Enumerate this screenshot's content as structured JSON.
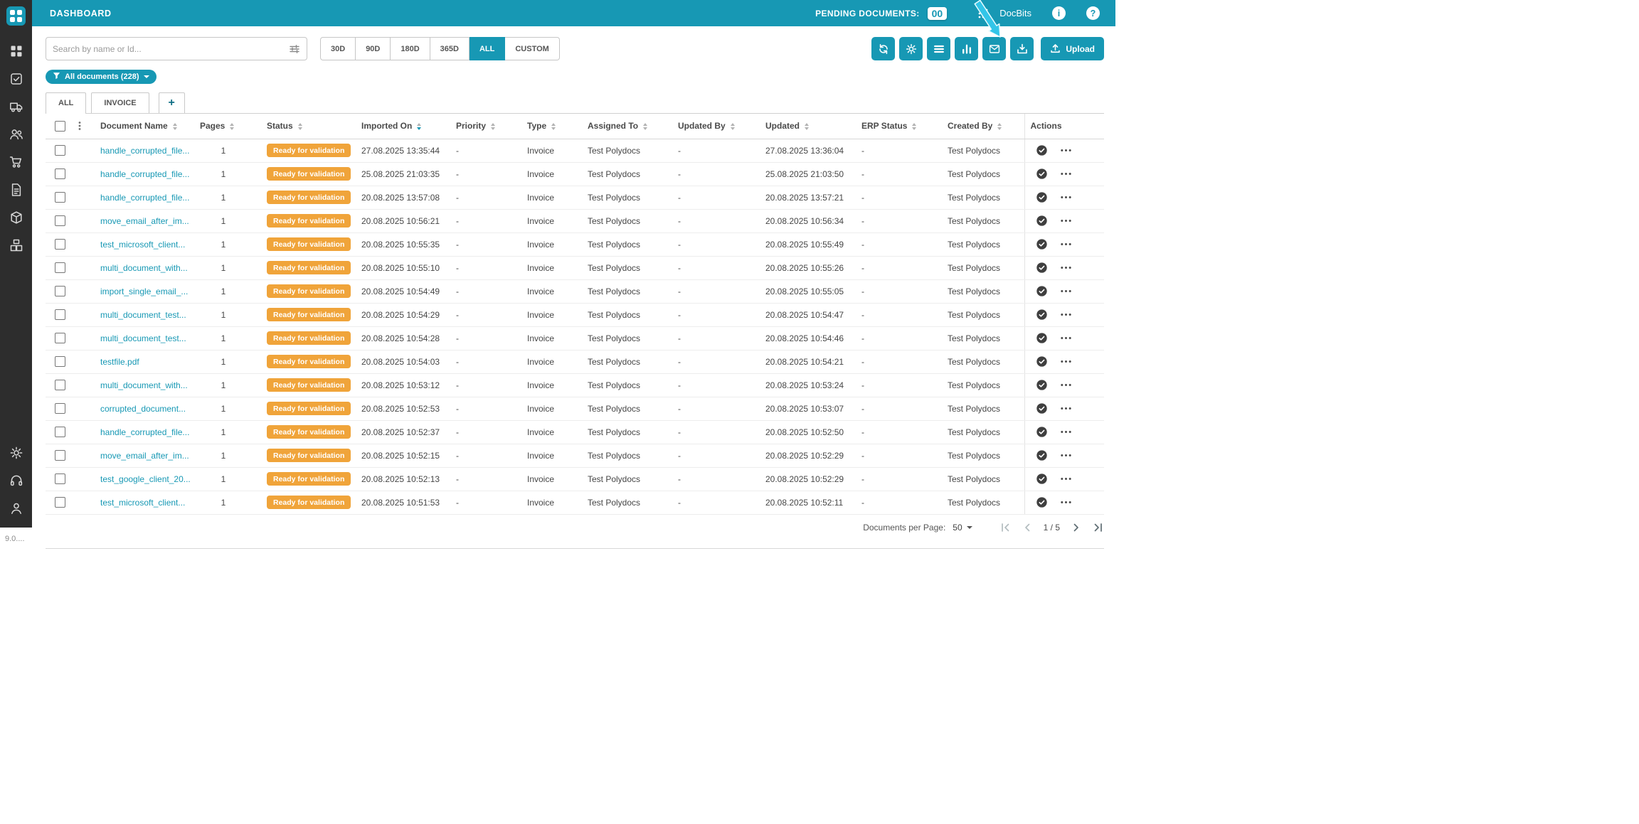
{
  "colors": {
    "accent": "#1798b4",
    "status_badge": "#F0A43A",
    "link": "#1798b4",
    "annotation": "#33C5E8",
    "sidebar_bg": "#2d2d2d"
  },
  "sidebar": {
    "icons": [
      "apps",
      "tasks",
      "shipping",
      "users",
      "cart",
      "invoices",
      "package",
      "packages"
    ],
    "bottom_icons": [
      "settings",
      "support",
      "profile"
    ],
    "version": "9.0...."
  },
  "header": {
    "title": "DASHBOARD",
    "pending_label": "PENDING DOCUMENTS:",
    "pending_count": "00",
    "brand": "DocBits",
    "info_glyph": "i",
    "help_glyph": "?"
  },
  "toolbar": {
    "search_placeholder": "Search by name or Id...",
    "ranges": [
      "30D",
      "90D",
      "180D",
      "365D",
      "ALL",
      "CUSTOM"
    ],
    "active_range": "ALL",
    "action_icons": [
      "sync",
      "settings",
      "list",
      "analytics",
      "email",
      "import"
    ],
    "upload_label": "Upload"
  },
  "filter_chip": {
    "label": "All documents (228)"
  },
  "tabs": {
    "items": [
      "ALL",
      "INVOICE"
    ],
    "active": "ALL",
    "add_label": "+"
  },
  "table": {
    "columns": [
      "Document Name",
      "Pages",
      "Status",
      "Imported On",
      "Priority",
      "Type",
      "Assigned To",
      "Updated By",
      "Updated",
      "ERP Status",
      "Created By",
      "Actions"
    ],
    "sorted_column": "Imported On",
    "sort_direction": "desc",
    "rows": [
      {
        "name": "handle_corrupted_file...",
        "pages": "1",
        "status": "Ready for validation",
        "imported": "27.08.2025 13:35:44",
        "priority": "-",
        "type": "Invoice",
        "assigned": "Test Polydocs",
        "updated_by": "-",
        "updated": "27.08.2025 13:36:04",
        "erp": "-",
        "created_by": "Test Polydocs"
      },
      {
        "name": "handle_corrupted_file...",
        "pages": "1",
        "status": "Ready for validation",
        "imported": "25.08.2025 21:03:35",
        "priority": "-",
        "type": "Invoice",
        "assigned": "Test Polydocs",
        "updated_by": "-",
        "updated": "25.08.2025 21:03:50",
        "erp": "-",
        "created_by": "Test Polydocs"
      },
      {
        "name": "handle_corrupted_file...",
        "pages": "1",
        "status": "Ready for validation",
        "imported": "20.08.2025 13:57:08",
        "priority": "-",
        "type": "Invoice",
        "assigned": "Test Polydocs",
        "updated_by": "-",
        "updated": "20.08.2025 13:57:21",
        "erp": "-",
        "created_by": "Test Polydocs"
      },
      {
        "name": "move_email_after_im...",
        "pages": "1",
        "status": "Ready for validation",
        "imported": "20.08.2025 10:56:21",
        "priority": "-",
        "type": "Invoice",
        "assigned": "Test Polydocs",
        "updated_by": "-",
        "updated": "20.08.2025 10:56:34",
        "erp": "-",
        "created_by": "Test Polydocs"
      },
      {
        "name": "test_microsoft_client...",
        "pages": "1",
        "status": "Ready for validation",
        "imported": "20.08.2025 10:55:35",
        "priority": "-",
        "type": "Invoice",
        "assigned": "Test Polydocs",
        "updated_by": "-",
        "updated": "20.08.2025 10:55:49",
        "erp": "-",
        "created_by": "Test Polydocs"
      },
      {
        "name": "multi_document_with...",
        "pages": "1",
        "status": "Ready for validation",
        "imported": "20.08.2025 10:55:10",
        "priority": "-",
        "type": "Invoice",
        "assigned": "Test Polydocs",
        "updated_by": "-",
        "updated": "20.08.2025 10:55:26",
        "erp": "-",
        "created_by": "Test Polydocs"
      },
      {
        "name": "import_single_email_...",
        "pages": "1",
        "status": "Ready for validation",
        "imported": "20.08.2025 10:54:49",
        "priority": "-",
        "type": "Invoice",
        "assigned": "Test Polydocs",
        "updated_by": "-",
        "updated": "20.08.2025 10:55:05",
        "erp": "-",
        "created_by": "Test Polydocs"
      },
      {
        "name": "multi_document_test...",
        "pages": "1",
        "status": "Ready for validation",
        "imported": "20.08.2025 10:54:29",
        "priority": "-",
        "type": "Invoice",
        "assigned": "Test Polydocs",
        "updated_by": "-",
        "updated": "20.08.2025 10:54:47",
        "erp": "-",
        "created_by": "Test Polydocs"
      },
      {
        "name": "multi_document_test...",
        "pages": "1",
        "status": "Ready for validation",
        "imported": "20.08.2025 10:54:28",
        "priority": "-",
        "type": "Invoice",
        "assigned": "Test Polydocs",
        "updated_by": "-",
        "updated": "20.08.2025 10:54:46",
        "erp": "-",
        "created_by": "Test Polydocs"
      },
      {
        "name": "testfile.pdf",
        "pages": "1",
        "status": "Ready for validation",
        "imported": "20.08.2025 10:54:03",
        "priority": "-",
        "type": "Invoice",
        "assigned": "Test Polydocs",
        "updated_by": "-",
        "updated": "20.08.2025 10:54:21",
        "erp": "-",
        "created_by": "Test Polydocs"
      },
      {
        "name": "multi_document_with...",
        "pages": "1",
        "status": "Ready for validation",
        "imported": "20.08.2025 10:53:12",
        "priority": "-",
        "type": "Invoice",
        "assigned": "Test Polydocs",
        "updated_by": "-",
        "updated": "20.08.2025 10:53:24",
        "erp": "-",
        "created_by": "Test Polydocs"
      },
      {
        "name": "corrupted_document...",
        "pages": "1",
        "status": "Ready for validation",
        "imported": "20.08.2025 10:52:53",
        "priority": "-",
        "type": "Invoice",
        "assigned": "Test Polydocs",
        "updated_by": "-",
        "updated": "20.08.2025 10:53:07",
        "erp": "-",
        "created_by": "Test Polydocs"
      },
      {
        "name": "handle_corrupted_file...",
        "pages": "1",
        "status": "Ready for validation",
        "imported": "20.08.2025 10:52:37",
        "priority": "-",
        "type": "Invoice",
        "assigned": "Test Polydocs",
        "updated_by": "-",
        "updated": "20.08.2025 10:52:50",
        "erp": "-",
        "created_by": "Test Polydocs"
      },
      {
        "name": "move_email_after_im...",
        "pages": "1",
        "status": "Ready for validation",
        "imported": "20.08.2025 10:52:15",
        "priority": "-",
        "type": "Invoice",
        "assigned": "Test Polydocs",
        "updated_by": "-",
        "updated": "20.08.2025 10:52:29",
        "erp": "-",
        "created_by": "Test Polydocs"
      },
      {
        "name": "test_google_client_20...",
        "pages": "1",
        "status": "Ready for validation",
        "imported": "20.08.2025 10:52:13",
        "priority": "-",
        "type": "Invoice",
        "assigned": "Test Polydocs",
        "updated_by": "-",
        "updated": "20.08.2025 10:52:29",
        "erp": "-",
        "created_by": "Test Polydocs"
      },
      {
        "name": "test_microsoft_client...",
        "pages": "1",
        "status": "Ready for validation",
        "imported": "20.08.2025 10:51:53",
        "priority": "-",
        "type": "Invoice",
        "assigned": "Test Polydocs",
        "updated_by": "-",
        "updated": "20.08.2025 10:52:11",
        "erp": "-",
        "created_by": "Test Polydocs"
      }
    ]
  },
  "pagination": {
    "per_page_label": "Documents per Page:",
    "per_page": "50",
    "page_info": "1 / 5"
  }
}
